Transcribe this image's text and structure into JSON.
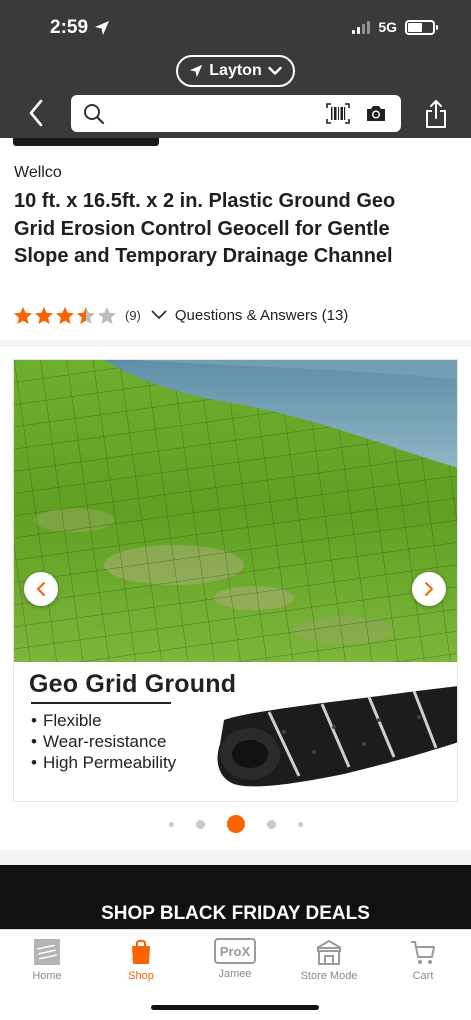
{
  "status_bar": {
    "time": "2:59",
    "network": "5G"
  },
  "location": {
    "store_name": "Layton"
  },
  "search": {
    "placeholder": ""
  },
  "product": {
    "brand": "Wellco",
    "title": "10 ft. x 16.5ft. x 2 in. Plastic Ground Geo Grid Erosion Control Geocell for Gentle Slope and Temporary Drainage Channel",
    "rating": 3.5,
    "review_count": "(9)",
    "qa_label": "Questions & Answers (13)"
  },
  "gallery": {
    "banner_title": "Geo Grid Ground",
    "bullets": [
      "Flexible",
      "Wear-resistance",
      "High Permeability"
    ],
    "total_images": 5,
    "active_index": 2
  },
  "promo": {
    "text": "SHOP BLACK FRIDAY DEALS"
  },
  "tabs": [
    {
      "label": "Home",
      "icon": "home-depot-logo-icon",
      "active": false
    },
    {
      "label": "Shop",
      "icon": "shop-bag-icon",
      "active": true
    },
    {
      "label": "Jamee",
      "icon": "prox-icon",
      "active": false
    },
    {
      "label": "Store Mode",
      "icon": "store-icon",
      "active": false
    },
    {
      "label": "Cart",
      "icon": "cart-icon",
      "active": false
    }
  ],
  "colors": {
    "accent": "#f96302",
    "header_bg": "#3a3a3a",
    "star": "#f96302"
  }
}
